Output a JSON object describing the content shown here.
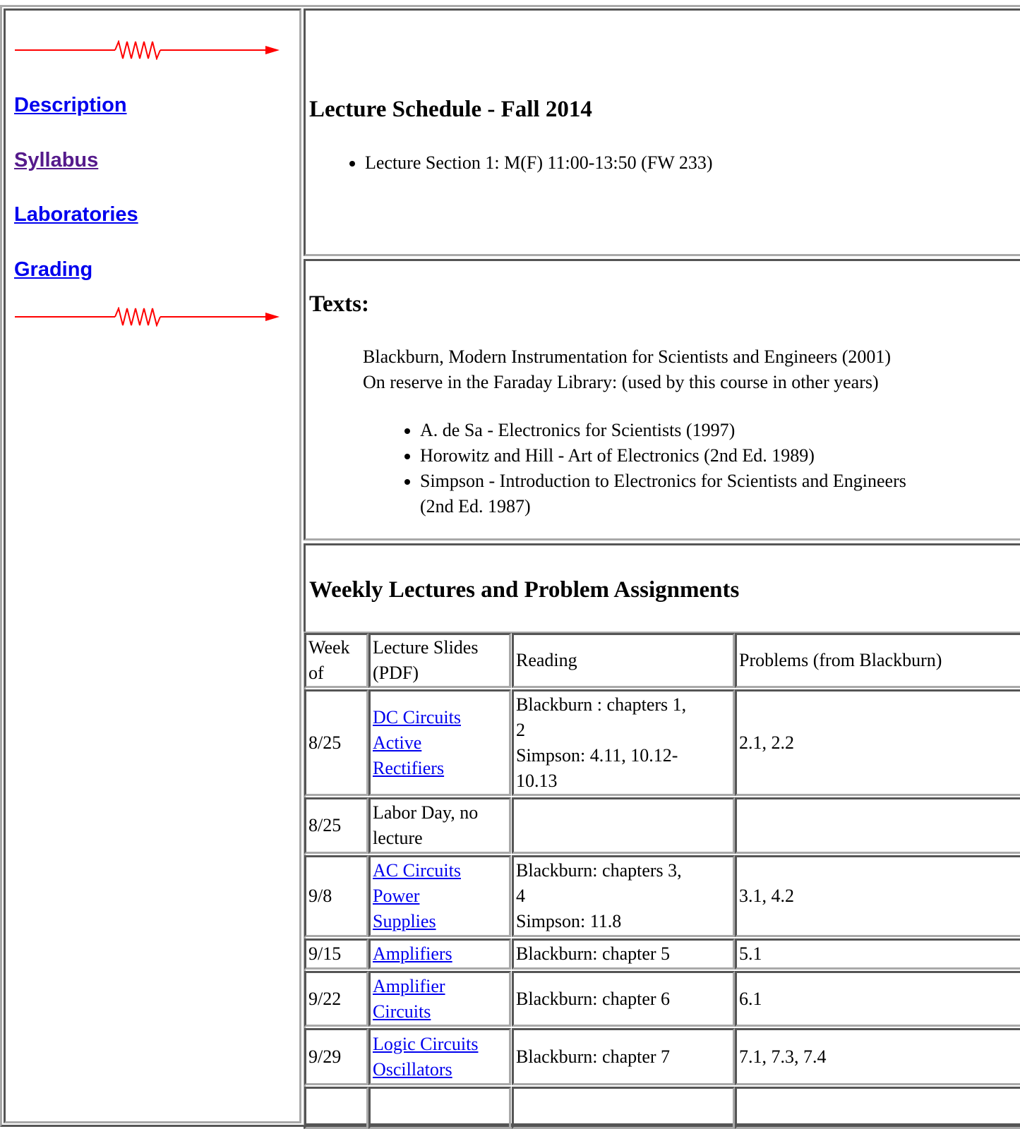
{
  "nav": {
    "links": [
      {
        "label": "Description",
        "visited": false
      },
      {
        "label": "Syllabus",
        "visited": true
      },
      {
        "label": "Laboratories",
        "visited": false
      },
      {
        "label": "Grading",
        "visited": false
      }
    ],
    "divider_icon": "resistor-arrow-icon",
    "divider_color": "#ff0000"
  },
  "schedule": {
    "title": "Lecture Schedule - Fall 2014",
    "sections": [
      "Lecture Section 1: M(F) 11:00-13:50 (FW 233)"
    ]
  },
  "texts": {
    "title": "Texts:",
    "main_text": "Blackburn, Modern Instrumentation for Scientists and Engineers (2001)",
    "reserve_note": "On reserve in the Faraday Library: (used by this course in other years)",
    "reserve_list": [
      "A. de Sa - Electronics for Scientists (1997)",
      "Horowitz and Hill - Art of Electronics (2nd Ed. 1989)",
      "Simpson - Introduction to Electronics for Scientists and Engineers",
      "(2nd Ed. 1987)"
    ]
  },
  "weekly": {
    "title": "Weekly Lectures and Problem Assignments",
    "headers": {
      "week": [
        "Week",
        "of"
      ],
      "slides": [
        "Lecture Slides",
        "(PDF)"
      ],
      "reading": "Reading",
      "problems": "Problems (from Blackburn)"
    },
    "rows": [
      {
        "week": "8/25",
        "slides": [
          "DC Circuits",
          "Active",
          "Rectifiers"
        ],
        "slides_visited": [
          false,
          false,
          false
        ],
        "reading": [
          "Blackburn : chapters 1,",
          "2",
          "Simpson: 4.11, 10.12-",
          "10.13"
        ],
        "problems": "2.1, 2.2"
      },
      {
        "week": "8/25",
        "note": [
          "Labor Day, no",
          "lecture"
        ],
        "reading": [],
        "problems": ""
      },
      {
        "week": "9/8",
        "slides": [
          "AC Circuits",
          "Power",
          "Supplies"
        ],
        "slides_visited": [
          false,
          false,
          false
        ],
        "reading": [
          "Blackburn: chapters 3,",
          "4",
          "Simpson: 11.8"
        ],
        "problems": "3.1, 4.2"
      },
      {
        "week": "9/15",
        "slides": [
          "Amplifiers"
        ],
        "slides_visited": [
          false
        ],
        "reading": [
          "Blackburn: chapter 5"
        ],
        "problems": "5.1"
      },
      {
        "week": "9/22",
        "slides": [
          "Amplifier",
          "Circuits"
        ],
        "slides_visited": [
          false,
          false
        ],
        "reading": [
          "Blackburn: chapter 6"
        ],
        "problems": "6.1"
      },
      {
        "week": "9/29",
        "slides": [
          "Logic Circuits",
          "Oscillators"
        ],
        "slides_visited": [
          false,
          false
        ],
        "reading": [
          "Blackburn: chapter 7"
        ],
        "problems": "7.1, 7.3, 7.4"
      }
    ]
  }
}
